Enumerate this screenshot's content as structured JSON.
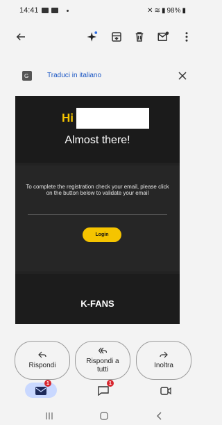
{
  "status_bar": {
    "time": "14:41",
    "battery": "98%"
  },
  "translate_bar": {
    "text": "Traduci in italiano"
  },
  "email": {
    "greeting": "Hi",
    "title": "Almost there!",
    "message": "To complete the registration check your email, please click on the button below to validate your email",
    "login_label": "Login",
    "brand": "K-FANS",
    "colors": {
      "accent": "#f5c400",
      "background": "#222222"
    }
  },
  "actions": {
    "reply": "Rispondi",
    "reply_all": "Rispondi a tutti",
    "forward": "Inoltra"
  },
  "bottom_nav": {
    "mail_badge": "1",
    "chat_badge": "1"
  },
  "icons": [
    "back-arrow-icon",
    "sparkle-icon",
    "archive-icon",
    "delete-icon",
    "mark-unread-icon",
    "more-icon",
    "translate-icon",
    "close-icon",
    "reply-icon",
    "reply-all-icon",
    "forward-icon",
    "mail-icon",
    "chat-icon",
    "video-icon"
  ]
}
